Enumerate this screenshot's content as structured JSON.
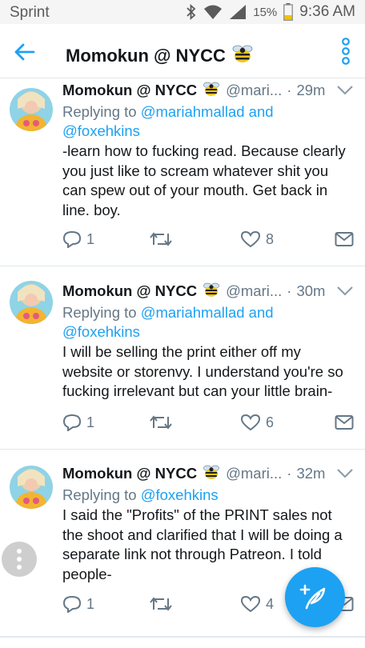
{
  "statusbar": {
    "carrier": "Sprint",
    "battery_pct": "15%",
    "time": "9:36 AM"
  },
  "header": {
    "title": "Momokun @ NYCC"
  },
  "tweets": [
    {
      "name": "Momokun @ NYCC",
      "handle": "@mari...",
      "time": "29m",
      "replying_prefix": "Replying to",
      "replying_to": "@mariahmallad and @foxehkins",
      "text": "-learn how to fucking read. Because clearly you just like to scream whatever shit you can spew out of your mouth. Get back in line. boy.",
      "replies": "1",
      "retweets": "",
      "likes": "8"
    },
    {
      "name": "Momokun @ NYCC",
      "handle": "@mari...",
      "time": "30m",
      "replying_prefix": "Replying to",
      "replying_to": "@mariahmallad and @foxehkins",
      "text": "I will be selling the print either off my website or storenvy. I understand you're so fucking irrelevant but can your little brain-",
      "replies": "1",
      "retweets": "",
      "likes": "6"
    },
    {
      "name": "Momokun @ NYCC",
      "handle": "@mari...",
      "time": "32m",
      "replying_prefix": "Replying to",
      "replying_to": "@foxehkins",
      "text": "I said the \"Profits\" of the PRINT sales not the shoot and clarified that I will be doing a separate link not through Patreon. I told people-",
      "replies": "1",
      "retweets": "",
      "likes": "4"
    }
  ],
  "colors": {
    "accent": "#1da1f2",
    "secondary_text": "#657786",
    "divider": "#e1e8ed"
  },
  "icons": {
    "back": "arrow-left-icon",
    "more": "more-vertical-icon",
    "reply": "reply-icon",
    "retweet": "retweet-icon",
    "like": "heart-icon",
    "dm": "envelope-icon",
    "compose": "compose-tweet-icon"
  }
}
